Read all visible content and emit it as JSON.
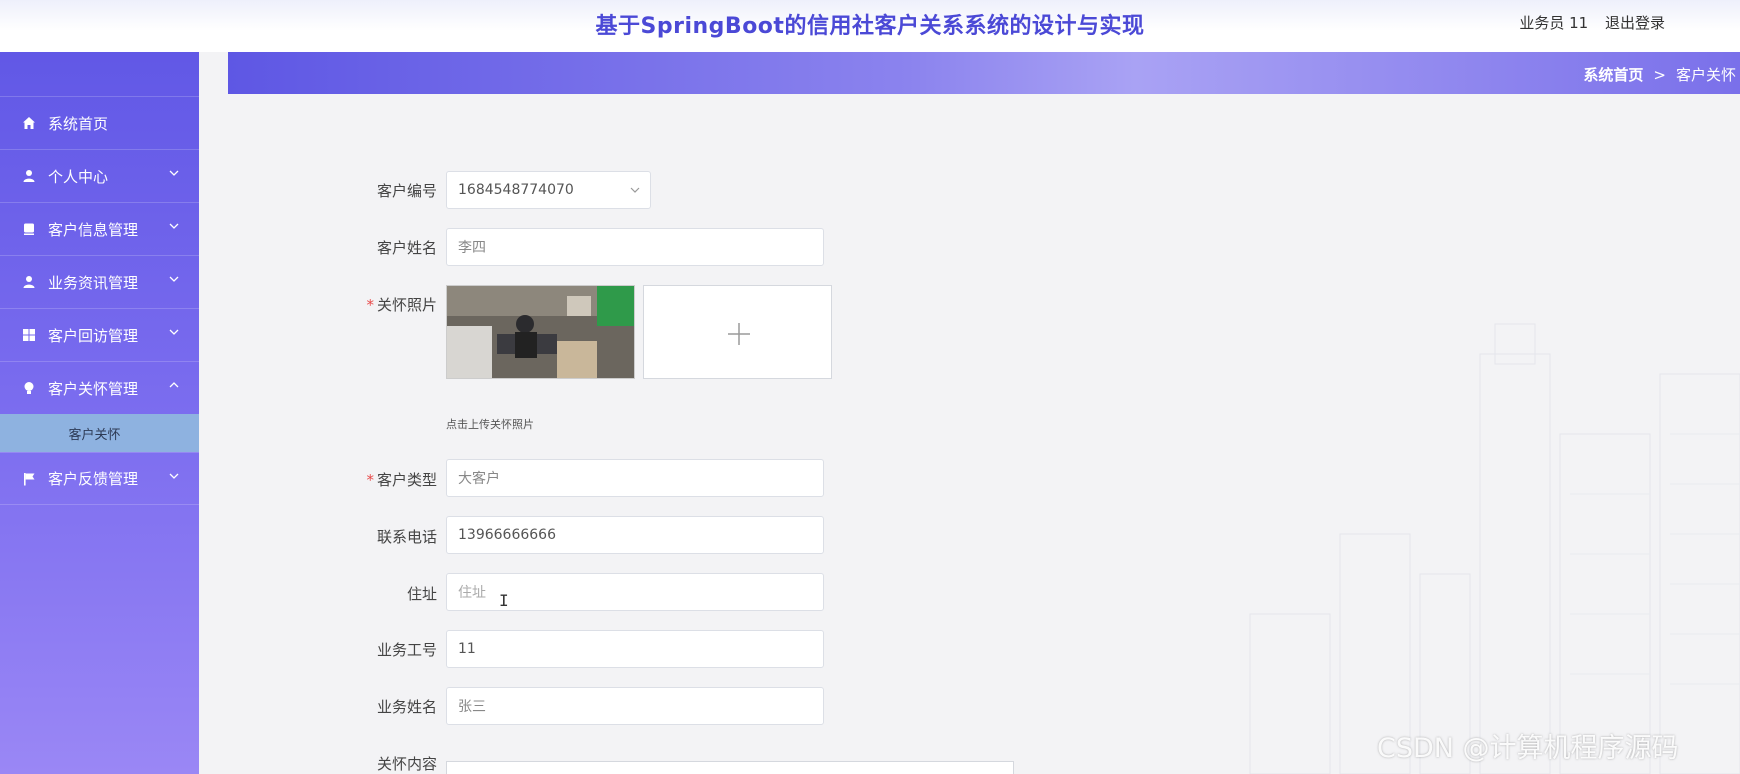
{
  "header": {
    "title": "基于SpringBoot的信用社客户关系系统的设计与实现",
    "user_label": "业务员 11",
    "logout_label": "退出登录"
  },
  "sidebar": {
    "items": [
      {
        "label": "系统首页",
        "icon": "home-icon"
      },
      {
        "label": "个人中心",
        "icon": "user-icon"
      },
      {
        "label": "客户信息管理",
        "icon": "card-icon"
      },
      {
        "label": "业务资讯管理",
        "icon": "person-icon"
      },
      {
        "label": "客户回访管理",
        "icon": "grid-icon"
      },
      {
        "label": "客户关怀管理",
        "icon": "bulb-icon"
      },
      {
        "label": "客户反馈管理",
        "icon": "flag-icon"
      }
    ],
    "subitem": "客户关怀"
  },
  "breadcrumb": {
    "home": "系统首页",
    "separator": ">",
    "current": "客户关怀"
  },
  "form": {
    "customer_id_label": "客户编号",
    "customer_id_value": "1684548774070",
    "customer_name_label": "客户姓名",
    "customer_name_value": "李四",
    "photo_label": "关怀照片",
    "photo_hint": "点击上传关怀照片",
    "customer_type_label": "客户类型",
    "customer_type_value": "大客户",
    "phone_label": "联系电话",
    "phone_value": "13966666666",
    "address_label": "住址",
    "address_placeholder": "住址",
    "staff_id_label": "业务工号",
    "staff_id_value": "11",
    "staff_name_label": "业务姓名",
    "staff_name_value": "张三",
    "content_label": "关怀内容",
    "required_mark": "*"
  },
  "watermark": "CSDN @计算机程序源码",
  "colors": {
    "accent": "#4b49d6",
    "sidebar_top": "#6158e6",
    "submenu_active": "#8eb2e0",
    "required": "#e84b4b"
  }
}
